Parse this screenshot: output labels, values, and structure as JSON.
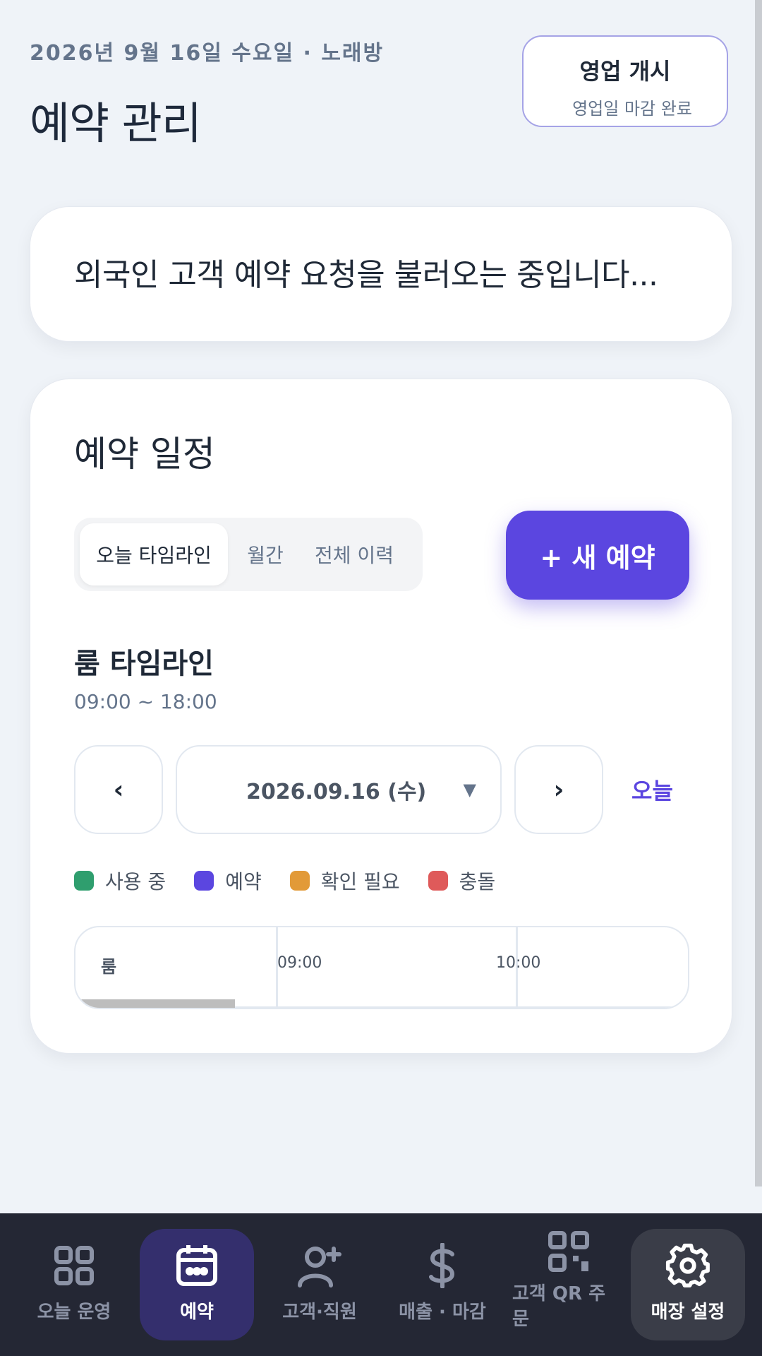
{
  "header": {
    "date_line": "2026년 9월 16일 수요일 · 노래방",
    "title": "예약 관리",
    "open_button": {
      "label": "영업 개시",
      "sub": "영업일 마감 완료"
    }
  },
  "loading": {
    "text": "외국인 고객 예약 요청을 불러오는 중입니다..."
  },
  "schedule": {
    "title": "예약 일정",
    "tabs": [
      "오늘 타임라인",
      "월간",
      "전체 이력"
    ],
    "active_tab": "오늘 타임라인",
    "new_button": "+ 새 예약",
    "timeline_title": "룸 타임라인",
    "hours": "09:00 ~ 18:00",
    "prev_label": "‹",
    "next_label": "›",
    "date_value": "2026.09.16 (수)",
    "today_label": "오늘",
    "legend": [
      {
        "label": "사용 중",
        "color": "#2f9e6e"
      },
      {
        "label": "예약",
        "color": "#5b46e0"
      },
      {
        "label": "확인 필요",
        "color": "#e29a38"
      },
      {
        "label": "충돌",
        "color": "#df5a5a"
      }
    ],
    "grid": {
      "room_header": "룸",
      "times": [
        "09:00",
        "10:00"
      ]
    }
  },
  "bottom_nav": {
    "items": [
      {
        "label": "오늘 운영",
        "icon": "grid-icon"
      },
      {
        "label": "예약",
        "icon": "calendar-icon"
      },
      {
        "label": "고객·직원",
        "icon": "user-add-icon"
      },
      {
        "label": "매출 · 마감",
        "icon": "dollar-icon"
      },
      {
        "label": "고객 QR 주문",
        "icon": "qr-icon"
      },
      {
        "label": "매장 설정",
        "icon": "gear-icon"
      }
    ],
    "active": "예약"
  }
}
